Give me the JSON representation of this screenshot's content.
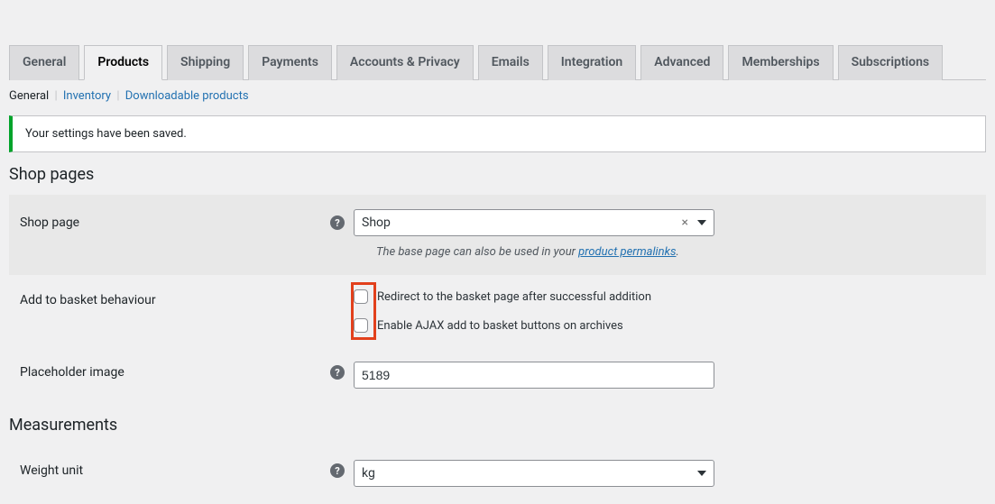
{
  "tabs": {
    "general": "General",
    "products": "Products",
    "shipping": "Shipping",
    "payments": "Payments",
    "accounts": "Accounts & Privacy",
    "emails": "Emails",
    "integration": "Integration",
    "advanced": "Advanced",
    "memberships": "Memberships",
    "subscriptions": "Subscriptions"
  },
  "subnav": {
    "general": "General",
    "inventory": "Inventory",
    "downloadable": "Downloadable products"
  },
  "notice": {
    "saved": "Your settings have been saved."
  },
  "sections": {
    "shop_pages": "Shop pages",
    "measurements": "Measurements"
  },
  "shop_page": {
    "label": "Shop page",
    "value": "Shop",
    "clear": "×",
    "desc_pre": "The base page can also be used in your ",
    "desc_link": "product permalinks",
    "desc_post": "."
  },
  "add_to_basket": {
    "label": "Add to basket behaviour",
    "redirect": "Redirect to the basket page after successful addition",
    "ajax": "Enable AJAX add to basket buttons on archives"
  },
  "placeholder_image": {
    "label": "Placeholder image",
    "value": "5189"
  },
  "weight_unit": {
    "label": "Weight unit",
    "value": "kg"
  },
  "help_glyph": "?"
}
